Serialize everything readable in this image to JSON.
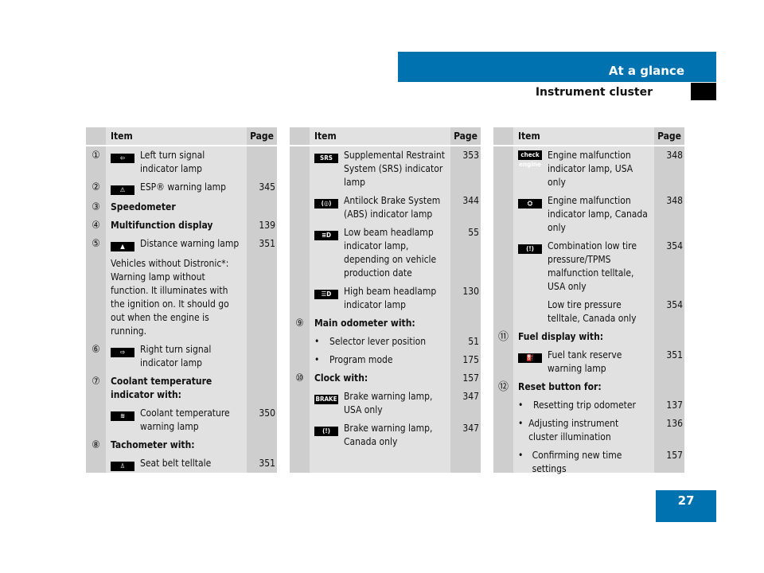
{
  "header": {
    "section": "At a glance",
    "subtitle": "Instrument cluster"
  },
  "page_number": "27",
  "colors": {
    "accent": "#0072b0",
    "table_bg": "#e1e1e1",
    "table_side": "#cecece"
  },
  "columns": [
    {
      "item_header": "Item",
      "page_header": "Page",
      "rows": [
        {
          "num": "①",
          "icon": "left-turn-signal-icon",
          "glyph": "⇦",
          "text": "Left turn signal indicator lamp",
          "page": ""
        },
        {
          "num": "②",
          "icon": "esp-warning-icon",
          "glyph": "⚠",
          "text": "ESP® warning lamp",
          "page": "345"
        },
        {
          "num": "③",
          "bold": true,
          "text": "Speedometer",
          "page": ""
        },
        {
          "num": "④",
          "bold": true,
          "text": "Multifunction display",
          "page": "139"
        },
        {
          "num": "⑤",
          "icon": "distance-warning-icon",
          "glyph": "▲",
          "text": "Distance warning lamp",
          "page": "351"
        },
        {
          "note": true,
          "text": "Vehicles without Distronic*: Warning lamp without function. It illuminates with the ignition on. It should go out when the engine is running.",
          "page": ""
        },
        {
          "num": "⑥",
          "icon": "right-turn-signal-icon",
          "glyph": "⇨",
          "text": "Right turn signal indicator lamp",
          "page": ""
        },
        {
          "num": "⑦",
          "bold": true,
          "text": "Coolant temperature indicator with:",
          "page": ""
        },
        {
          "icon": "coolant-temperature-icon",
          "glyph": "≋",
          "text": "Coolant temperature warning lamp",
          "page": "350"
        },
        {
          "num": "⑧",
          "bold": true,
          "text": "Tachometer with:",
          "page": ""
        },
        {
          "icon": "seat-belt-icon",
          "glyph": "♙",
          "text": "Seat belt telltale",
          "page": "351"
        }
      ]
    },
    {
      "item_header": "Item",
      "page_header": "Page",
      "rows": [
        {
          "icon": "srs-icon",
          "glyph": "SRS",
          "text": "Supplemental Restraint System (SRS) indicator lamp",
          "page": "353"
        },
        {
          "icon": "abs-icon",
          "glyph": "(◎)",
          "text": "Antilock Brake System (ABS) indicator lamp",
          "page": "344"
        },
        {
          "icon": "low-beam-icon",
          "glyph": "≡D",
          "text": "Low beam headlamp indicator lamp, depending on vehicle production date",
          "page": "55"
        },
        {
          "icon": "high-beam-icon",
          "glyph": "☰D",
          "text": "High beam headlamp indicator lamp",
          "page": "130"
        },
        {
          "num": "⑨",
          "bold": true,
          "text": "Main odometer with:",
          "page": ""
        },
        {
          "bullet": true,
          "text": "Selector lever position",
          "page": "51"
        },
        {
          "bullet": true,
          "text": "Program mode",
          "page": "175"
        },
        {
          "num": "⑩",
          "bold": true,
          "text": "Clock with:",
          "page": "157"
        },
        {
          "icon": "brake-usa-icon",
          "glyph": "BRAKE",
          "text": "Brake warning lamp, USA only",
          "page": "347"
        },
        {
          "icon": "brake-canada-icon",
          "glyph": "(!)",
          "text": "Brake warning lamp, Canada only",
          "page": "347"
        }
      ]
    },
    {
      "item_header": "Item",
      "page_header": "Page",
      "rows": [
        {
          "icon": "check-engine-icon",
          "glyph": "check engine",
          "text": "Engine malfunction indicator lamp, USA only",
          "page": "348"
        },
        {
          "icon": "engine-icon",
          "glyph": "⛭",
          "text": "Engine malfunction indicator lamp, Canada only",
          "page": "348"
        },
        {
          "icon": "tire-pressure-icon",
          "glyph": "(!)",
          "text": "Combination low tire pressure/TPMS malfunction telltale, USA only",
          "page": "354"
        },
        {
          "text": "Low tire pressure telltale, Canada only",
          "page": "354"
        },
        {
          "num": "⑪",
          "bold": true,
          "text": "Fuel display with:",
          "page": ""
        },
        {
          "icon": "fuel-icon",
          "glyph": "⛽",
          "text": "Fuel tank reserve warning lamp",
          "page": "351"
        },
        {
          "num": "⑫",
          "bold": true,
          "text": "Reset button for:",
          "page": ""
        },
        {
          "bullet": true,
          "text": "Resetting trip odometer",
          "page": "137"
        },
        {
          "bullet": true,
          "text": "Adjusting instrument cluster illumination",
          "page": "136"
        },
        {
          "bullet": true,
          "text": "Confirming new time settings",
          "page": "157"
        }
      ]
    }
  ]
}
